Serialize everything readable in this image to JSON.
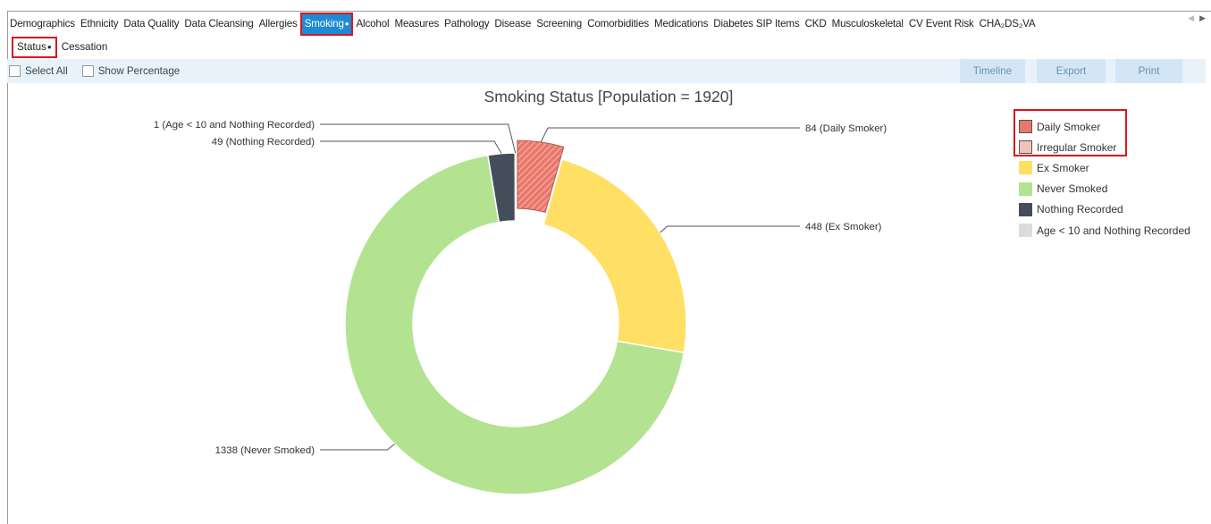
{
  "main_tabs": [
    "Demographics",
    "Ethnicity",
    "Data Quality",
    "Data Cleansing",
    "Allergies",
    "Smoking",
    "Alcohol",
    "Measures",
    "Pathology",
    "Disease",
    "Screening",
    "Comorbidities",
    "Medications",
    "Diabetes SIP Items",
    "CKD",
    "Musculoskeletal",
    "CV Event Risk",
    "CHA₂DS₂VA"
  ],
  "active_main_tab": "Smoking",
  "sub_tabs": [
    "Status",
    "Cessation"
  ],
  "active_sub_tab": "Status",
  "toolbar": {
    "select_all": "Select All",
    "show_percentage": "Show Percentage",
    "timeline": "Timeline",
    "export": "Export",
    "print": "Print"
  },
  "chart_data": {
    "type": "pie",
    "variant": "donut",
    "title": "Smoking Status [Population = 1920]",
    "slices": [
      {
        "name": "Daily Smoker",
        "value": 84,
        "label": "84 (Daily Smoker)",
        "color": "#e9786b",
        "pattern": "hatched",
        "exploded": true
      },
      {
        "name": "Irregular Smoker",
        "value": 0,
        "label": "",
        "color": "#f5c1bc",
        "pattern": "hatched",
        "exploded": false
      },
      {
        "name": "Ex Smoker",
        "value": 448,
        "label": "448 (Ex Smoker)",
        "color": "#ffdf64",
        "pattern": "solid",
        "exploded": false
      },
      {
        "name": "Never Smoked",
        "value": 1338,
        "label": "1338 (Never Smoked)",
        "color": "#b3e391",
        "pattern": "solid",
        "exploded": false
      },
      {
        "name": "Nothing Recorded",
        "value": 49,
        "label": "49 (Nothing Recorded)",
        "color": "#454d5a",
        "pattern": "solid",
        "exploded": false
      },
      {
        "name": "Age < 10 and Nothing Recorded",
        "value": 1,
        "label": "1 (Age < 10 and Nothing Recorded)",
        "color": "#dcdcdc",
        "pattern": "solid",
        "exploded": false
      }
    ],
    "legend": [
      {
        "name": "Daily Smoker",
        "color": "#e9786b"
      },
      {
        "name": "Irregular Smoker",
        "color": "#f5c1bc"
      },
      {
        "name": "Ex Smoker",
        "color": "#ffdf64"
      },
      {
        "name": "Never Smoked",
        "color": "#b3e391"
      },
      {
        "name": "Nothing Recorded",
        "color": "#454d5a"
      },
      {
        "name": "Age < 10 and Nothing Recorded",
        "color": "#dcdcdc"
      }
    ],
    "legend_placement": "right"
  },
  "colors": {
    "active_tab": "#1e8ad6",
    "highlight": "#d8171d",
    "toolbar_bg": "#e7f2fb"
  },
  "icons": {
    "tab_scroll_left": "chevron-left-icon",
    "tab_scroll_right": "chevron-right-icon"
  }
}
